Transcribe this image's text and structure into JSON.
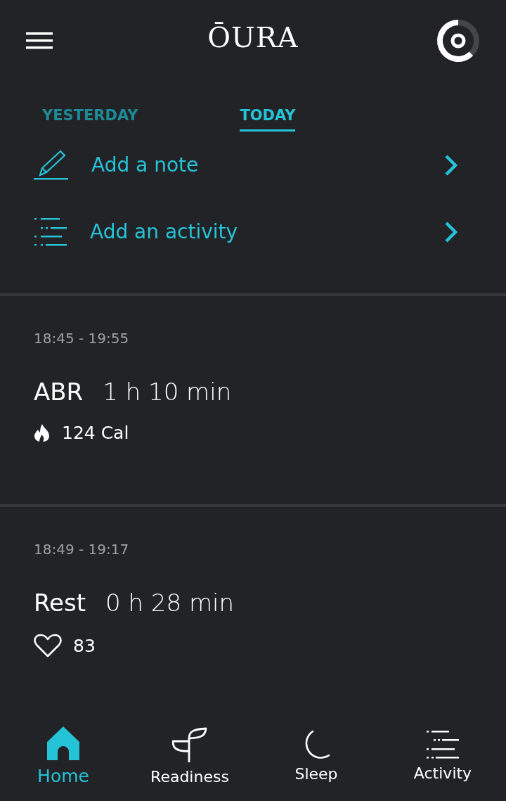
{
  "header": {
    "logo": "ŌURA"
  },
  "tabs": [
    {
      "label": "YESTERDAY",
      "selected": false
    },
    {
      "label": "TODAY",
      "selected": true
    }
  ],
  "actions": [
    {
      "kind": "note",
      "label": "Add a note"
    },
    {
      "kind": "activity",
      "label": "Add an activity"
    }
  ],
  "activities": [
    {
      "time": "18:45 - 19:55",
      "name": "ABR",
      "duration": "1 h 10 min",
      "kind": "calories",
      "metric": "124 Cal"
    },
    {
      "time": "18:49 - 19:17",
      "name": "Rest",
      "duration": "0 h 28 min",
      "kind": "heart_rate",
      "metric": "83"
    }
  ],
  "nav": [
    {
      "kind": "home",
      "label": "Home",
      "selected": true
    },
    {
      "kind": "readiness",
      "label": "Readiness",
      "selected": false
    },
    {
      "kind": "sleep",
      "label": "Sleep",
      "selected": false
    },
    {
      "kind": "activity",
      "label": "Activity",
      "selected": false
    }
  ]
}
